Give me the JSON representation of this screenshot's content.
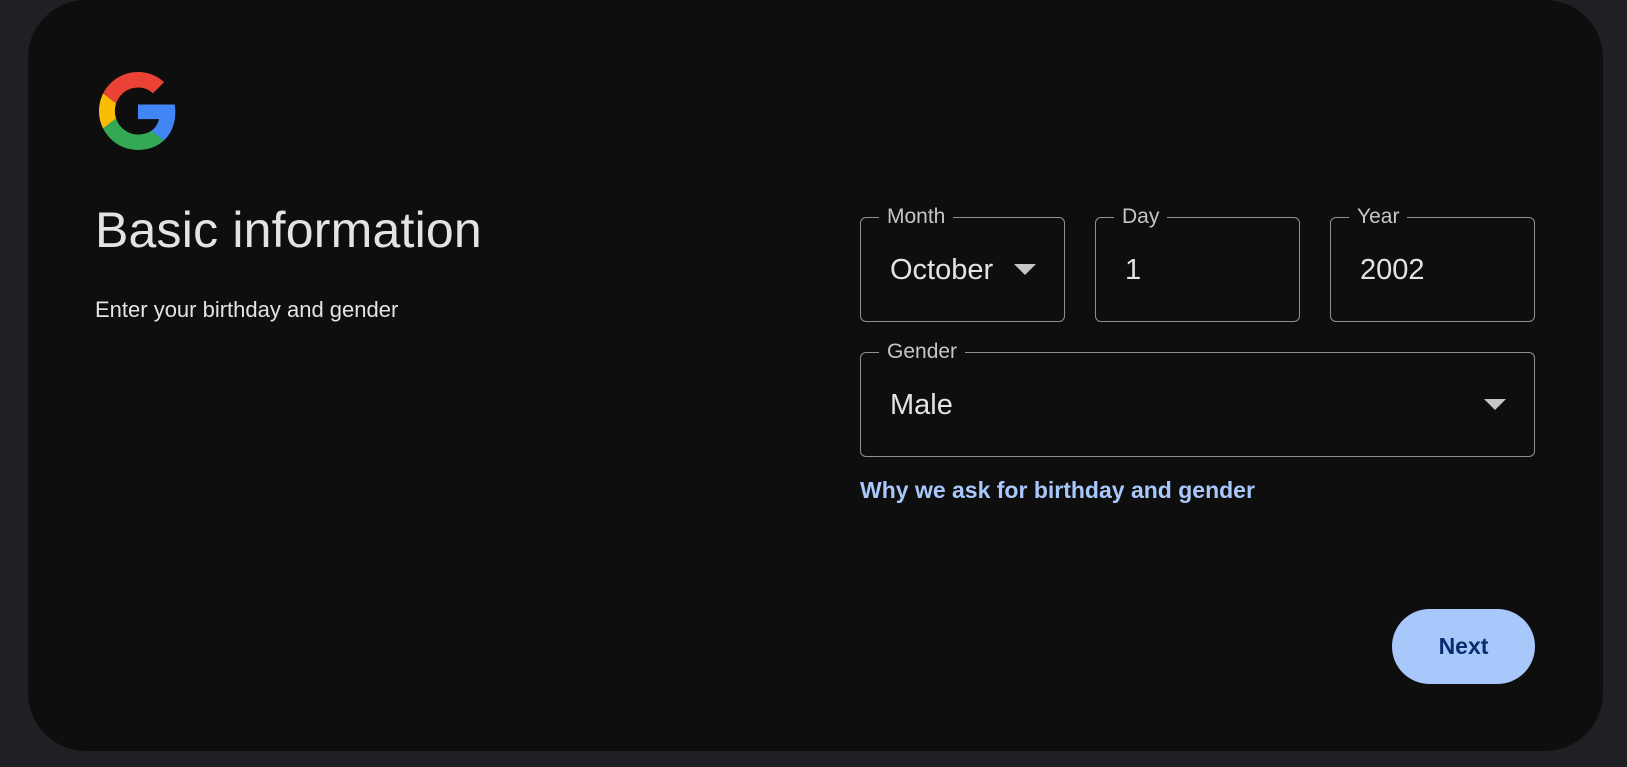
{
  "logo": {
    "icon": "google-g-icon",
    "colors": {
      "red": "#EA4335",
      "yellow": "#FBBC05",
      "green": "#34A853",
      "blue": "#4285F4"
    }
  },
  "heading": {
    "title": "Basic information",
    "subtitle": "Enter your birthday and gender"
  },
  "form": {
    "month": {
      "label": "Month",
      "value": "October",
      "icon": "caret-down-icon"
    },
    "day": {
      "label": "Day",
      "value": "1"
    },
    "year": {
      "label": "Year",
      "value": "2002"
    },
    "gender": {
      "label": "Gender",
      "value": "Male",
      "icon": "caret-down-icon"
    },
    "why_link": "Why we ask for birthday and gender"
  },
  "actions": {
    "next_label": "Next"
  },
  "colors": {
    "page_bg": "#1f2023",
    "card_bg": "#0e0e0e",
    "text": "#e3e3e3",
    "link": "#a8c7fa",
    "button_bg": "#a8c7fa",
    "button_text": "#062e6f",
    "field_border": "#8e918f"
  }
}
